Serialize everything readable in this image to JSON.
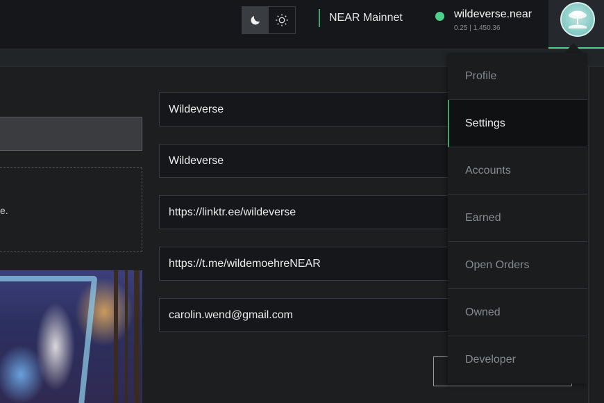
{
  "header": {
    "theme": {
      "dark_icon": "moon-icon",
      "light_icon": "sun-icon",
      "active": "dark"
    },
    "network_label": "NEAR Mainnet",
    "account": {
      "name": "wildeverse.near",
      "balance": "0.25 | 1,450.36",
      "status_color": "#4cd08a"
    },
    "avatar_icon": "avatar-tree-logo"
  },
  "left": {
    "dropzone_text": "e."
  },
  "form": {
    "fields": [
      {
        "value": "Wildeverse"
      },
      {
        "value": "Wildeverse"
      },
      {
        "value": "https://linktr.ee/wildeverse"
      },
      {
        "value": "https://t.me/wildemoehreNEAR"
      },
      {
        "value": "carolin.wend@gmail.com"
      }
    ]
  },
  "menu": {
    "items": [
      {
        "label": "Profile"
      },
      {
        "label": "Settings",
        "active": true
      },
      {
        "label": "Accounts"
      },
      {
        "label": "Earned"
      },
      {
        "label": "Open Orders"
      },
      {
        "label": "Owned"
      },
      {
        "label": "Developer"
      }
    ]
  },
  "colors": {
    "accent": "#3fa36a",
    "background": "#1c1e1f",
    "header": "#15171a"
  }
}
